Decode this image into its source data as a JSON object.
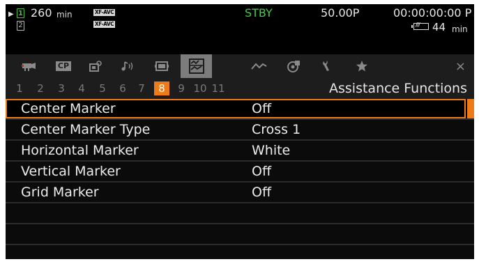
{
  "status": {
    "play_indicator": "▶",
    "card_slot_1": "1",
    "card_slot_2": "2",
    "remaining_minutes": "260",
    "minutes_unit": "min",
    "format_1": "XF-AVC",
    "format_2": "XF-AVC",
    "mode": "STBY",
    "frame_rate": "50.00P",
    "timecode": "00:00:00:00",
    "timecode_suffix": "P",
    "battery_minutes": "44",
    "battery_unit": "min"
  },
  "tabs": [
    {
      "name": "camera-icon",
      "active": false
    },
    {
      "name": "custom-picture-icon",
      "text": "CP",
      "active": false
    },
    {
      "name": "camera-setup-icon",
      "active": false
    },
    {
      "name": "audio-icon",
      "active": false
    },
    {
      "name": "recording-media-icon",
      "active": false
    },
    {
      "name": "assistance-functions-icon",
      "active": true
    },
    {
      "name": "network-icon",
      "active": false
    },
    {
      "name": "playback-icon",
      "active": false
    },
    {
      "name": "system-setup-icon",
      "active": false
    },
    {
      "name": "my-menu-icon",
      "active": false
    }
  ],
  "close_symbol": "×",
  "pages": [
    "1",
    "2",
    "3",
    "4",
    "5",
    "6",
    "7",
    "8",
    "9",
    "10",
    "11"
  ],
  "active_page": "8",
  "section_title": "Assistance Functions",
  "menu": {
    "items": [
      {
        "label": "Center Marker",
        "value": "Off",
        "selected": true
      },
      {
        "label": "Center Marker Type",
        "value": "Cross 1",
        "selected": false
      },
      {
        "label": "Horizontal Marker",
        "value": "White",
        "selected": false
      },
      {
        "label": "Vertical Marker",
        "value": "Off",
        "selected": false
      },
      {
        "label": "Grid Marker",
        "value": "Off",
        "selected": false
      }
    ],
    "empty_rows": 3
  },
  "colors": {
    "accent": "#ee7a18",
    "standby": "#3ecf3a",
    "slot_active": "#49c23a",
    "background": "#000000",
    "tab_bar": "#1d1d1d"
  }
}
